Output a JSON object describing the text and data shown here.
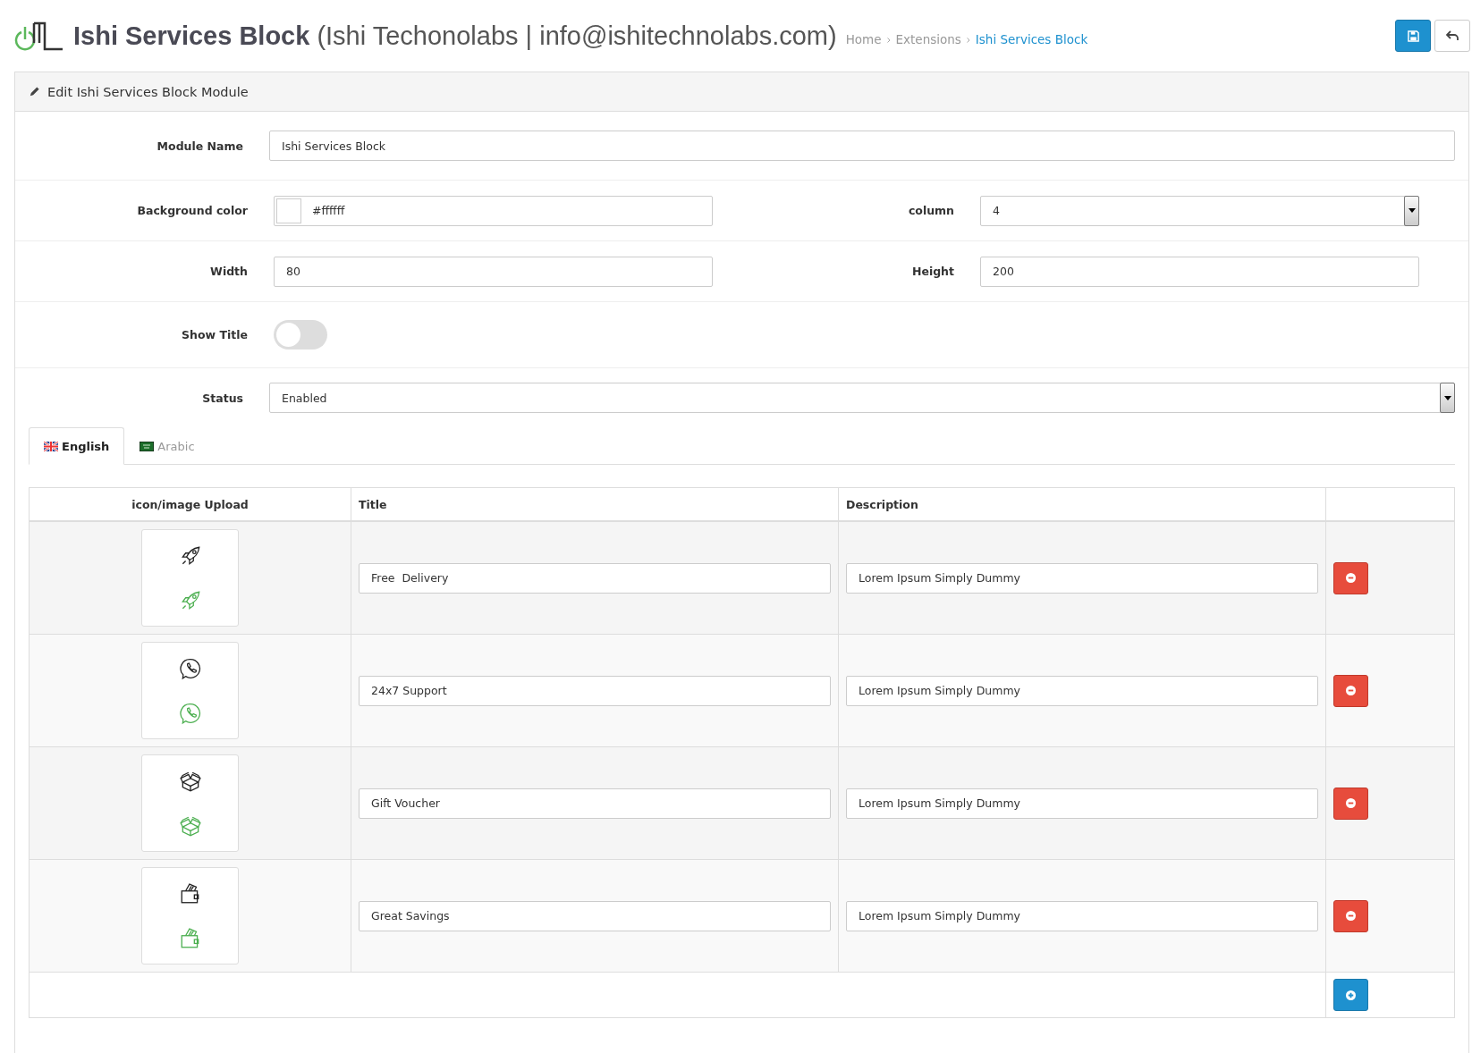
{
  "header": {
    "title": "Ishi Services Block",
    "subtitle": "(Ishi Techonolabs | info@ishitechnolabs.com)",
    "breadcrumbs": [
      {
        "label": "Home",
        "current": false
      },
      {
        "label": "Extensions",
        "current": false
      },
      {
        "label": "Ishi Services Block",
        "current": true
      }
    ]
  },
  "panel": {
    "heading": "Edit Ishi Services Block Module"
  },
  "form": {
    "module_name": {
      "label": "Module Name",
      "value": "Ishi Services Block"
    },
    "background_color": {
      "label": "Background color",
      "value": "#ffffff"
    },
    "column": {
      "label": "column",
      "value": "4"
    },
    "width": {
      "label": "Width",
      "value": "80"
    },
    "height": {
      "label": "Height",
      "value": "200"
    },
    "show_title": {
      "label": "Show Title",
      "on": false
    },
    "status": {
      "label": "Status",
      "value": "Enabled"
    }
  },
  "language_tabs": [
    {
      "label": "English",
      "kind": "uk",
      "selected": true
    },
    {
      "label": "Arabic",
      "kind": "sa",
      "selected": false
    }
  ],
  "table": {
    "columns": [
      "icon/image Upload",
      "Title",
      "Description"
    ],
    "rows": [
      {
        "kind": "rocket",
        "title": "Free  Delivery",
        "description": "Lorem Ipsum Simply Dummy"
      },
      {
        "kind": "phone",
        "title": "24x7 Support",
        "description": "Lorem Ipsum Simply Dummy"
      },
      {
        "kind": "box",
        "title": "Gift Voucher",
        "description": "Lorem Ipsum Simply Dummy"
      },
      {
        "kind": "wallet",
        "title": "Great Savings",
        "description": "Lorem Ipsum Simply Dummy"
      }
    ]
  }
}
